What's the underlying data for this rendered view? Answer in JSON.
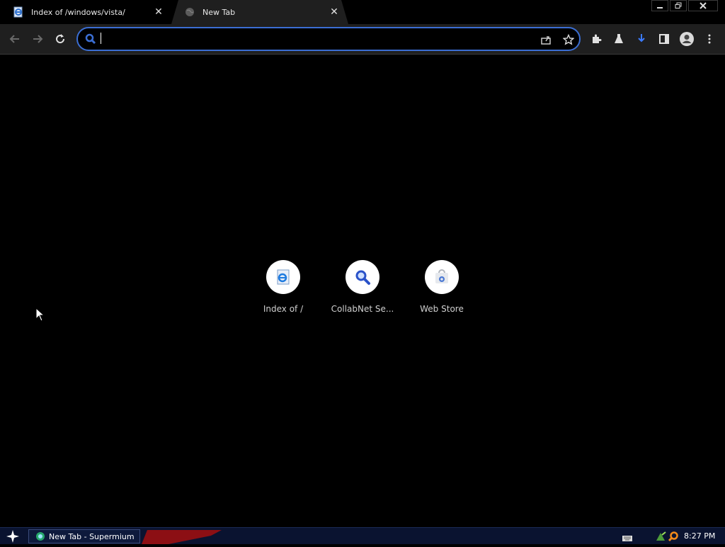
{
  "tabs": [
    {
      "title": "Index of /windows/vista/",
      "active": false,
      "favicon": "ie-page-icon"
    },
    {
      "title": "New Tab",
      "active": true,
      "favicon": "globe-icon"
    }
  ],
  "window_controls": {
    "minimize": "minimize-icon",
    "restore": "restore-icon",
    "close": "close-icon"
  },
  "toolbar": {
    "omnibox": {
      "value": "",
      "placeholder": ""
    },
    "buttons": [
      "back-icon",
      "forward-icon",
      "reload-icon",
      "share-icon",
      "bookmark-star-icon",
      "extensions-icon",
      "labs-flask-icon",
      "download-icon",
      "side-panel-icon",
      "profile-icon",
      "menu-icon"
    ]
  },
  "shortcuts": [
    {
      "label": "Index of /",
      "icon": "ie-page-icon"
    },
    {
      "label": "CollabNet Se...",
      "icon": "magnifier-icon"
    },
    {
      "label": "Web Store",
      "icon": "web-store-icon"
    }
  ],
  "taskbar": {
    "task_label": "New Tab - Supermium",
    "clock": "8:27 PM"
  },
  "colors": {
    "accent": "#3b6ed3",
    "background": "#000000",
    "toolbar": "#1f1f1f",
    "taskbar": "#0a1330"
  }
}
